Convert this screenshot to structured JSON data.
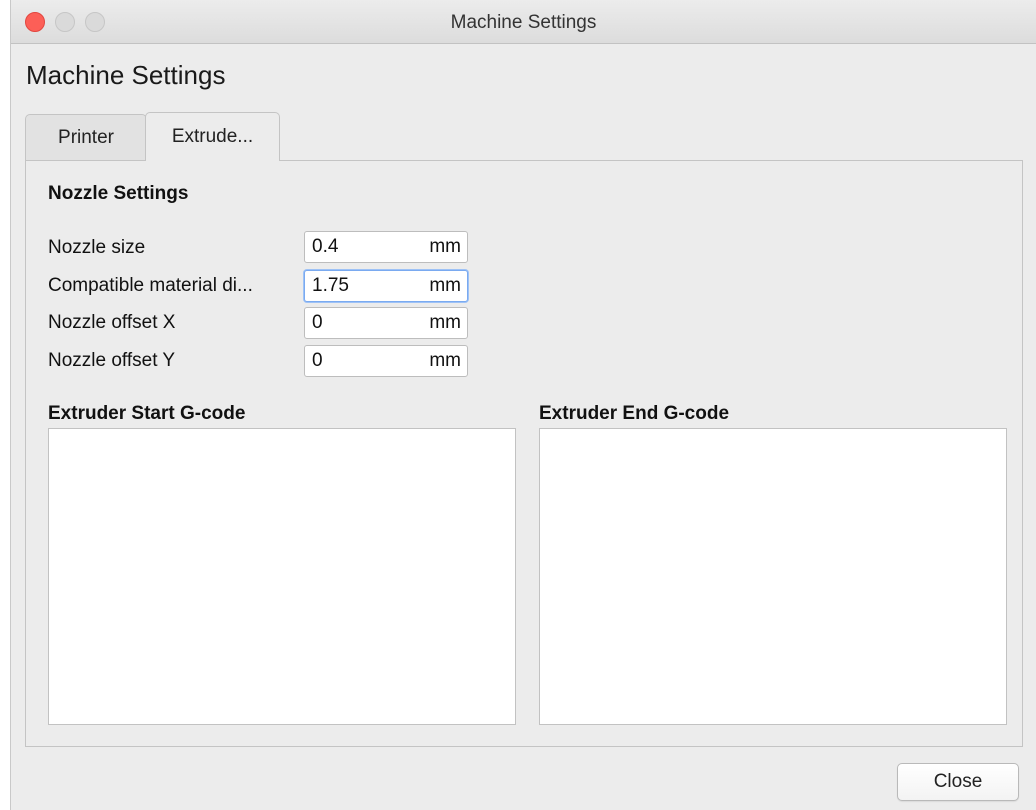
{
  "window": {
    "title": "Machine Settings"
  },
  "header": {
    "title": "Machine Settings"
  },
  "tabs": [
    {
      "label": "Printer",
      "active": false
    },
    {
      "label": "Extrude...",
      "active": true
    }
  ],
  "nozzle_settings": {
    "title": "Nozzle Settings",
    "fields": [
      {
        "label": "Nozzle size",
        "value": "0.4",
        "unit": "mm"
      },
      {
        "label": "Compatible material di...",
        "value": "1.75",
        "unit": "mm"
      },
      {
        "label": "Nozzle offset X",
        "value": "0",
        "unit": "mm"
      },
      {
        "label": "Nozzle offset Y",
        "value": "0",
        "unit": "mm"
      }
    ]
  },
  "gcode": {
    "start_title": "Extruder Start G-code",
    "start_value": "",
    "end_title": "Extruder End G-code",
    "end_value": ""
  },
  "footer": {
    "close_label": "Close"
  },
  "colors": {
    "close_traffic": "#fc5f57",
    "focus_ring": "#7aaaf0"
  }
}
